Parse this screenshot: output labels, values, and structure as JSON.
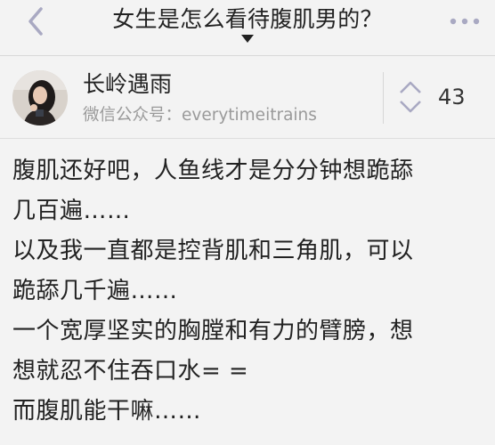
{
  "header": {
    "title": "女生是怎么看待腹肌男的？",
    "icons": {
      "back": "chevron-left-icon",
      "more": "more-dots-icon",
      "caret": "caret-down-icon"
    }
  },
  "author": {
    "name": "长岭遇雨",
    "bio": "微信公众号：everytimeitrains",
    "votes": "43"
  },
  "answer": {
    "lines": [
      "腹肌还好吧，人鱼线才是分分钟想跪舔",
      "几百遍……",
      "以及我一直都是控背肌和三角肌，可以",
      "跪舔几千遍……",
      "一个宽厚坚实的胸膛和有力的臂膀，想",
      "想就忍不住吞口水= =",
      "而腹肌能干嘛……"
    ]
  },
  "colors": {
    "background": "#f3f3f3",
    "text": "#222222",
    "secondary_text": "#9a9a9a",
    "icon_gray": "#a9a9c2"
  }
}
